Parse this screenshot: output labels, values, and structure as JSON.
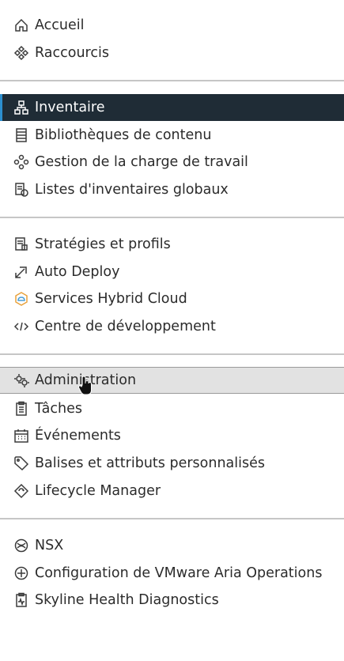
{
  "menu": {
    "items": [
      {
        "label": "Accueil",
        "icon": "home-icon"
      },
      {
        "label": "Raccourcis",
        "icon": "shortcuts-icon"
      },
      {
        "label": "Inventaire",
        "icon": "inventory-icon",
        "state": "selected"
      },
      {
        "label": "Bibliothèques de contenu",
        "icon": "content-library-icon"
      },
      {
        "label": "Gestion de la charge de travail",
        "icon": "workload-icon"
      },
      {
        "label": "Listes d'inventaires globaux",
        "icon": "global-inventory-icon"
      },
      {
        "label": "Stratégies et profils",
        "icon": "policies-icon"
      },
      {
        "label": "Auto Deploy",
        "icon": "auto-deploy-icon"
      },
      {
        "label": "Services Hybrid Cloud",
        "icon": "hybrid-cloud-icon"
      },
      {
        "label": "Centre de développement",
        "icon": "code-icon"
      },
      {
        "label": "Administration",
        "icon": "gears-icon",
        "state": "hover"
      },
      {
        "label": "Tâches",
        "icon": "clipboard-icon"
      },
      {
        "label": "Événements",
        "icon": "calendar-icon"
      },
      {
        "label": "Balises et attributs personnalisés",
        "icon": "tag-icon"
      },
      {
        "label": "Lifecycle Manager",
        "icon": "lifecycle-icon"
      },
      {
        "label": "NSX",
        "icon": "nsx-icon"
      },
      {
        "label": "Configuration de VMware Aria Operations",
        "icon": "plus-circle-icon"
      },
      {
        "label": "Skyline Health Diagnostics",
        "icon": "health-icon"
      }
    ]
  },
  "colors": {
    "selected_bg": "#1f2c36",
    "selected_accent": "#2c8fcf",
    "hover_bg": "#e2e2e2",
    "divider": "#c6c6c6",
    "hybrid_cloud_icon": "#e8a13a"
  }
}
